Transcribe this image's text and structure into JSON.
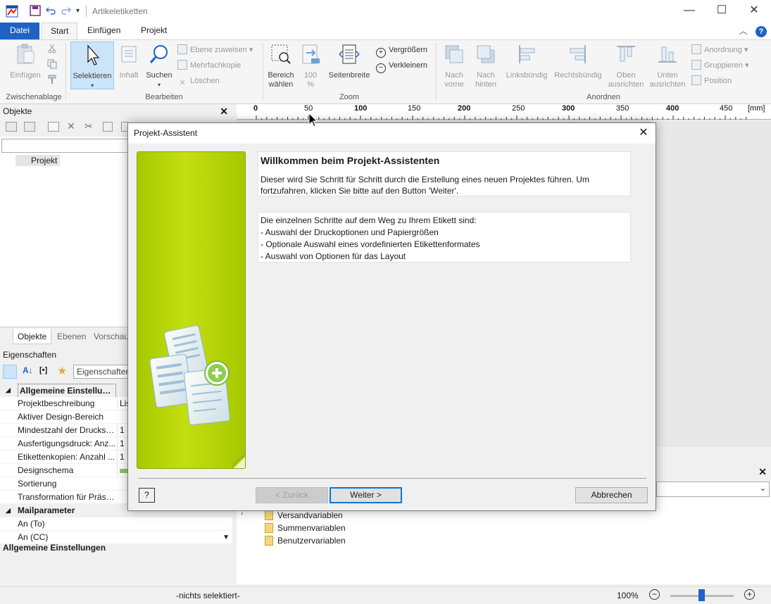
{
  "window": {
    "title": "Artikeletiketten"
  },
  "tabs": [
    {
      "label": "Datei"
    },
    {
      "label": "Start"
    },
    {
      "label": "Einfügen"
    },
    {
      "label": "Projekt"
    }
  ],
  "ribbon": {
    "clipboard": {
      "paste": "Einfügen",
      "group": "Zwischenablage"
    },
    "edit": {
      "select": "Selektieren",
      "content": "Inhalt",
      "search": "Suchen",
      "assign_layer": "Ebene zuweisen",
      "multi_copy": "Mehrfachkopie",
      "delete": "Löschen",
      "group": "Bearbeiten"
    },
    "zoom": {
      "area_line1": "Bereich",
      "area_line2": "wählen",
      "hundred_line1": "100",
      "hundred_line2": "%",
      "page_width": "Seitenbreite",
      "zoom_in": "Vergrößern",
      "zoom_out": "Verkleinern",
      "group": "Zoom"
    },
    "arrange": {
      "forward_line1": "Nach",
      "forward_line2": "vorne",
      "back_line1": "Nach",
      "back_line2": "hinten",
      "align_left": "Linksbündig",
      "align_right": "Rechtsbündig",
      "align_top_line1": "Oben",
      "align_top_line2": "ausrichten",
      "align_bottom_line1": "Unten",
      "align_bottom_line2": "ausrichten",
      "order": "Anordnung",
      "group_btn": "Gruppieren",
      "position": "Position",
      "group": "Anordnen"
    }
  },
  "objects_panel": {
    "title": "Objekte",
    "tree_item": "Projekt"
  },
  "bottom_tabs": [
    "Objekte",
    "Ebenen",
    "Vorschau"
  ],
  "properties": {
    "title": "Eigenschaften",
    "filter_placeholder": "Eigenschaften",
    "rows": [
      {
        "name": "Allgemeine Einstellungen",
        "value": "",
        "category": true
      },
      {
        "name": "Projektbeschreibung",
        "value": "Lis",
        "category": false
      },
      {
        "name": "Aktiver Design-Bereich",
        "value": "",
        "category": false
      },
      {
        "name": "Mindestzahl der Druckse...",
        "value": "1",
        "category": false
      },
      {
        "name": "Ausfertigungsdruck: Anz...",
        "value": "1",
        "category": false
      },
      {
        "name": "Etikettenkopien: Anzahl ...",
        "value": "1",
        "category": false
      },
      {
        "name": "Designschema",
        "value": "",
        "category": false
      },
      {
        "name": "Sortierung",
        "value": "",
        "category": false
      },
      {
        "name": "Transformation für Präse...",
        "value": "",
        "category": false
      },
      {
        "name": "Mailparameter",
        "value": "",
        "category": true
      },
      {
        "name": "An (To)",
        "value": "",
        "category": false
      },
      {
        "name": "An (CC)",
        "value": "",
        "category": false
      }
    ],
    "footer": "Allgemeine Einstellungen"
  },
  "ruler": {
    "unit": "[mm]",
    "labels": [
      "0",
      "50",
      "100",
      "150",
      "200",
      "250",
      "300",
      "350",
      "400",
      "450"
    ]
  },
  "variables": [
    {
      "label": "Versandvariablen"
    },
    {
      "label": "Summenvariablen"
    },
    {
      "label": "Benutzervariablen"
    }
  ],
  "status": {
    "selection": "-nichts selektiert-",
    "zoom": "100%"
  },
  "dialog": {
    "title": "Projekt-Assistent",
    "heading": "Willkommen beim Projekt-Assistenten",
    "intro": "Dieser wird Sie Schritt für Schritt durch die Erstellung eines neuen Projektes führen. Um fortzufahren, klicken Sie bitte auf den Button 'Weiter'.",
    "steps_intro": "Die einzelnen Schritte auf dem Weg zu Ihrem Etikett sind:",
    "steps": [
      "- Auswahl der Druckoptionen und Papiergrößen",
      "- Optionale Auswahl eines vordefinierten Etikettenformates",
      "- Auswahl von Optionen für das Layout"
    ],
    "back": "< Zurück",
    "next": "Weiter >",
    "cancel": "Abbrechen",
    "help": "?"
  }
}
